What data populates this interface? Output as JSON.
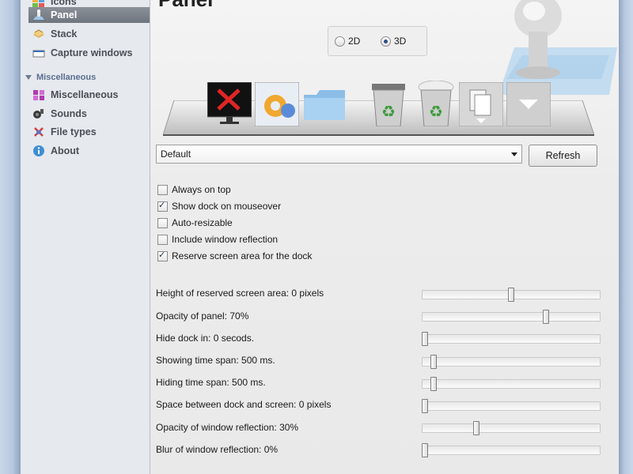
{
  "page": {
    "title": "Panel"
  },
  "sidebar": {
    "items_top": [
      {
        "label": "Icons",
        "icon": "icons-icon"
      },
      {
        "label": "Panel",
        "icon": "panel-icon",
        "selected": true
      },
      {
        "label": "Stack",
        "icon": "stack-icon"
      },
      {
        "label": "Capture windows",
        "icon": "capture-windows-icon"
      }
    ],
    "section": "Miscellaneous",
    "items_misc": [
      {
        "label": "Miscellaneous",
        "icon": "miscellaneous-icon"
      },
      {
        "label": "Sounds",
        "icon": "sounds-icon"
      },
      {
        "label": "File types",
        "icon": "file-types-icon"
      },
      {
        "label": "About",
        "icon": "about-icon"
      }
    ]
  },
  "view_mode": {
    "option_2d": "2D",
    "option_3d": "3D",
    "selected": "3D"
  },
  "theme": {
    "selected": "Default",
    "refresh_label": "Refresh"
  },
  "options": [
    {
      "label": "Always on top",
      "checked": false
    },
    {
      "label": "Show dock on mouseover",
      "checked": true
    },
    {
      "label": "Auto-resizable",
      "checked": false
    },
    {
      "label": "Include window reflection",
      "checked": false
    },
    {
      "label": "Reserve screen area for the dock",
      "checked": true
    }
  ],
  "sliders": [
    {
      "label": "Height of reserved screen area: 0 pixels",
      "value": 0.5
    },
    {
      "label": "Opacity of panel: 70%",
      "value": 0.7
    },
    {
      "label": "Hide dock in: 0 secods.",
      "value": 0.0
    },
    {
      "label": "Showing time span: 500 ms.",
      "value": 0.05
    },
    {
      "label": "Hiding time span: 500 ms.",
      "value": 0.05
    },
    {
      "label": "Space between dock and screen: 0 pixels",
      "value": 0.0
    },
    {
      "label": "Opacity of window reflection: 30%",
      "value": 0.3
    },
    {
      "label": "Blur of window reflection: 0%",
      "value": 0.0
    }
  ],
  "dock_preview": [
    {
      "name": "xp-monitor-icon"
    },
    {
      "name": "settings-icon"
    },
    {
      "name": "folder-icon"
    },
    {
      "name": "recycle-bin-empty-icon"
    },
    {
      "name": "recycle-bin-full-icon"
    },
    {
      "name": "stack-documents-icon"
    },
    {
      "name": "dropdown-arrow-icon"
    }
  ],
  "colors": {
    "selection": "#7a8089",
    "accent": "#2e4f86"
  }
}
